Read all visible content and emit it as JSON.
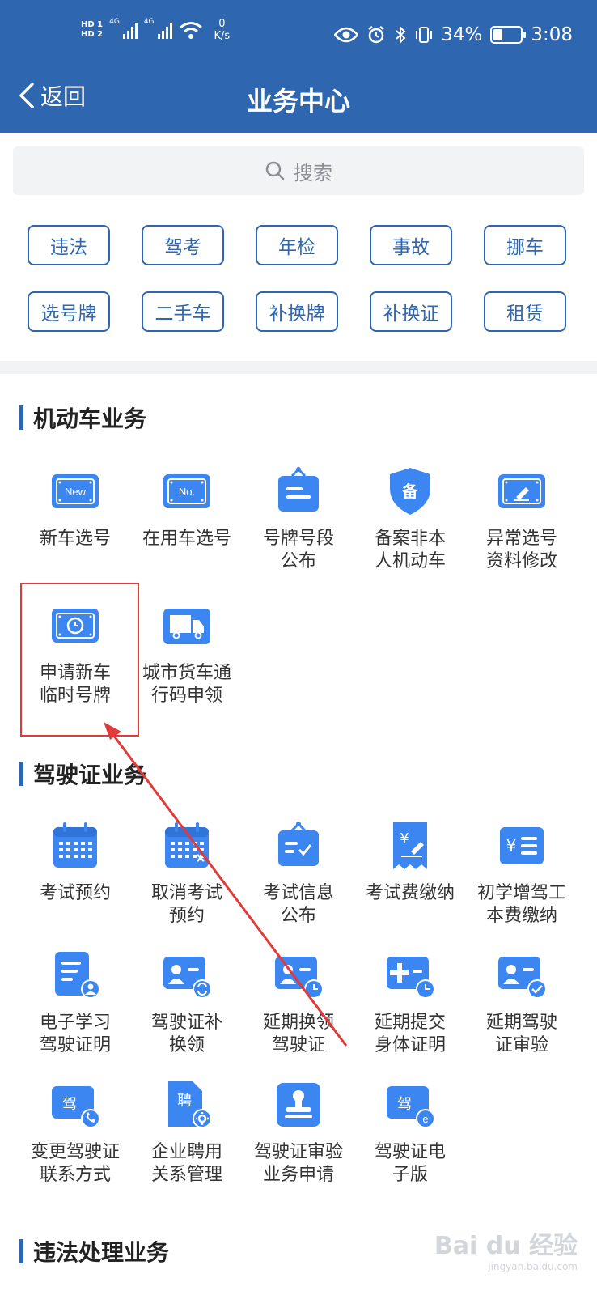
{
  "status_bar": {
    "hd1": "HD 1",
    "hd2": "HD 2",
    "net1": "4G",
    "net2": "4G",
    "speed_value": "0",
    "speed_unit": "K/s",
    "battery_percent": "34%",
    "battery_level": 0.34,
    "time": "3:08"
  },
  "header": {
    "back_label": "返回",
    "title": "业务中心",
    "background": "#2e66b0"
  },
  "search": {
    "placeholder": "搜索"
  },
  "quick_tags": [
    "违法",
    "驾考",
    "年检",
    "事故",
    "挪车",
    "选号牌",
    "二手车",
    "补换牌",
    "补换证",
    "租赁"
  ],
  "sections": {
    "vehicle": {
      "title": "机动车业务",
      "items": [
        {
          "label": "新车选号",
          "icon": "new-plate-icon",
          "glyph": "New"
        },
        {
          "label": "在用车选号",
          "icon": "no-plate-icon",
          "glyph": "No."
        },
        {
          "label": "号牌号段\n公布",
          "icon": "notice-board-icon"
        },
        {
          "label": "备案非本\n人机动车",
          "icon": "shield-icon",
          "glyph": "备"
        },
        {
          "label": "异常选号\n资料修改",
          "icon": "plate-edit-icon"
        },
        {
          "label": "申请新车\n临时号牌",
          "icon": "plate-clock-icon"
        },
        {
          "label": "城市货车通\n行码申领",
          "icon": "truck-icon"
        }
      ]
    },
    "license": {
      "title": "驾驶证业务",
      "items": [
        {
          "label": "考试预约",
          "icon": "calendar-icon"
        },
        {
          "label": "取消考试\n预约",
          "icon": "calendar-cancel-icon"
        },
        {
          "label": "考试信息\n公布",
          "icon": "notice-check-icon"
        },
        {
          "label": "考试费缴纳",
          "icon": "fee-receipt-icon",
          "glyph": "¥"
        },
        {
          "label": "初学增驾工\n本费缴纳",
          "icon": "fee-list-icon",
          "glyph": "¥"
        },
        {
          "label": "电子学习\n驾驶证明",
          "icon": "document-user-icon"
        },
        {
          "label": "驾驶证补\n换领",
          "icon": "id-exchange-icon"
        },
        {
          "label": "延期换领\n驾驶证",
          "icon": "id-clock-icon"
        },
        {
          "label": "延期提交\n身体证明",
          "icon": "medical-clock-icon"
        },
        {
          "label": "延期驾驶\n证审验",
          "icon": "id-check-icon"
        },
        {
          "label": "变更驾驶证\n联系方式",
          "icon": "card-phone-icon",
          "glyph": "驾"
        },
        {
          "label": "企业聘用\n关系管理",
          "icon": "employ-gear-icon",
          "glyph": "聘"
        },
        {
          "label": "驾驶证审验\n业务申请",
          "icon": "stamp-icon"
        },
        {
          "label": "驾驶证电\n子版",
          "icon": "card-e-icon",
          "glyph": "驾"
        }
      ]
    },
    "violation": {
      "title": "违法处理业务"
    }
  },
  "watermark": {
    "brand": "Bai du 经验",
    "sub": "jingyan.baidu.com"
  },
  "colors": {
    "accent": "#2e66b0",
    "icon_blue": "#3b86f0",
    "highlight": "#e03a3a"
  }
}
